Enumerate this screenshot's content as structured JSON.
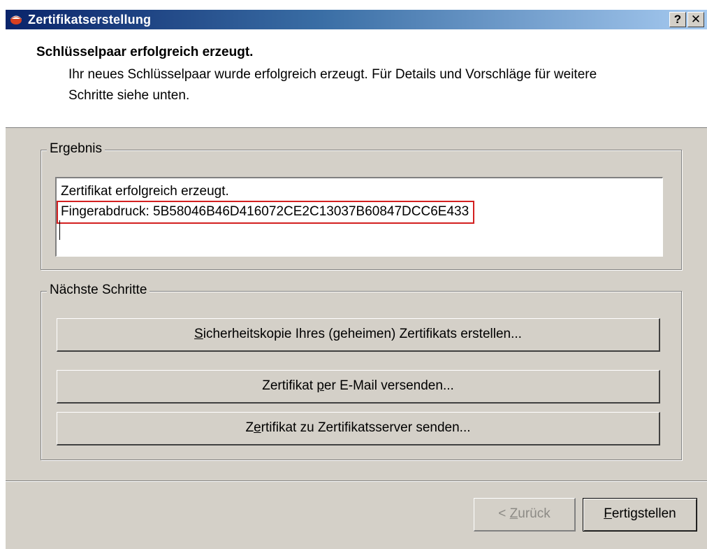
{
  "window": {
    "title": "Zertifikatserstellung",
    "help_label": "?",
    "close_label": "✕"
  },
  "header": {
    "title": "Schlüsselpaar erfolgreich erzeugt.",
    "description": "Ihr neues Schlüsselpaar wurde erfolgreich erzeugt. Für Details und Vorschläge für weitere Schritte siehe unten."
  },
  "result": {
    "legend": "Ergebnis",
    "line1": "Zertifikat erfolgreich erzeugt.",
    "line2": "Fingerabdruck: 5B58046B46D416072CE2C13037B60847DCC6E433"
  },
  "next_steps": {
    "legend": "Nächste Schritte",
    "buttons": [
      {
        "label": "Sicherheitskopie Ihres (geheimen) Zertifikats erstellen...",
        "mnemonic": "S"
      },
      {
        "label": "Zertifikat per E-Mail versenden...",
        "mnemonic": "p"
      },
      {
        "label": "Zertifikat zu Zertifikatsserver senden...",
        "mnemonic": "e"
      }
    ]
  },
  "footer": {
    "back_label": "< Zurück",
    "finish_label": "Fertigstellen"
  },
  "colors": {
    "titlebar_start": "#0a246a",
    "titlebar_end": "#a6caf0",
    "dialog_bg": "#d4d0c8",
    "highlight_box": "#d32020"
  }
}
